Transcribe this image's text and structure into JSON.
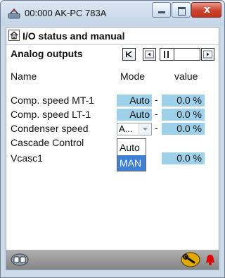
{
  "window": {
    "title": "00:000 AK-PC 783A",
    "close_glyph": "x"
  },
  "header": {
    "title": "I/O status and manual"
  },
  "section": {
    "title": "Analog outputs"
  },
  "columns": {
    "name": "Name",
    "mode": "Mode",
    "value": "value"
  },
  "rows": [
    {
      "label": "Comp. speed MT-1",
      "mode": "Auto",
      "dash": "-",
      "value": "0.0 %"
    },
    {
      "label": "Comp. speed LT-1",
      "mode": "Auto",
      "dash": "-",
      "value": "0.0 %"
    },
    {
      "label": "Condenser speed",
      "mode": "A...",
      "dash": "-",
      "value": "0.0 %"
    },
    {
      "label": "Cascade Control"
    },
    {
      "label": "Vcasc1",
      "value": "0.0 %"
    }
  ],
  "dropdown": {
    "options": [
      "Auto",
      "MAN"
    ],
    "highlighted": "MAN"
  },
  "colors": {
    "cell_bg": "#9fd0e9",
    "selection": "#3f80d5",
    "alarm_bell": "#e00000",
    "wrench_badge": "#e0a800"
  }
}
